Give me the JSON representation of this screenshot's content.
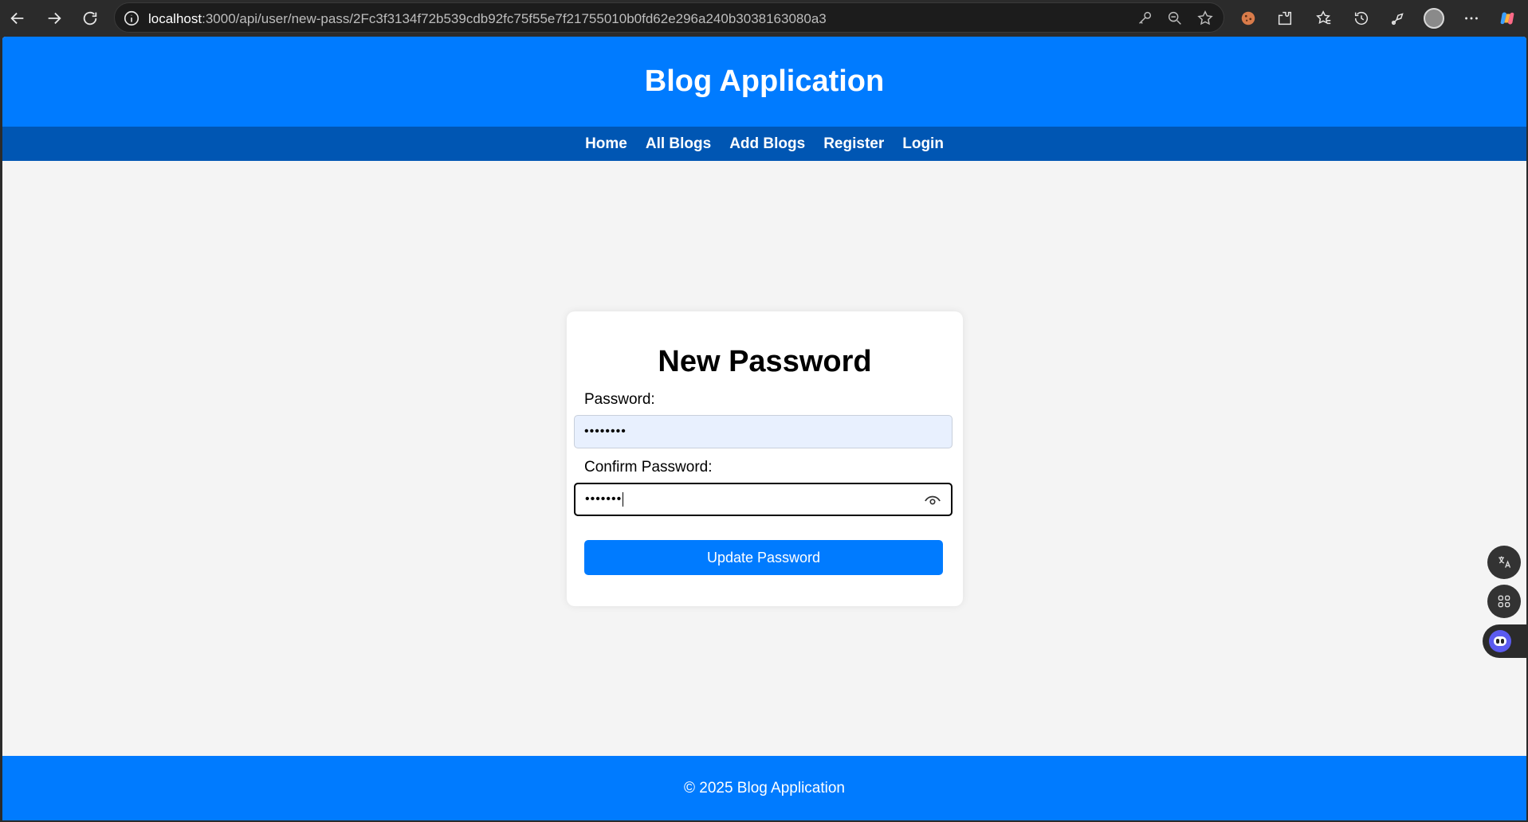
{
  "browser": {
    "url_host": "localhost",
    "url_path": ":3000/api/user/new-pass/2Fc3f3134f72b539cdb92fc75f55e7f21755010b0fd62e296a240b3038163080a3"
  },
  "header": {
    "title": "Blog Application"
  },
  "nav": {
    "items": [
      {
        "label": "Home"
      },
      {
        "label": "All Blogs"
      },
      {
        "label": "Add Blogs"
      },
      {
        "label": "Register"
      },
      {
        "label": "Login"
      }
    ]
  },
  "form": {
    "title": "New Password",
    "password_label": "Password:",
    "password_value": "••••••••",
    "confirm_label": "Confirm Password:",
    "confirm_value": "•••••••",
    "submit_label": "Update Password"
  },
  "footer": {
    "text": "© 2025 Blog Application"
  },
  "colors": {
    "primary": "#007bff",
    "nav": "#0056b3",
    "background": "#f4f4f4"
  }
}
